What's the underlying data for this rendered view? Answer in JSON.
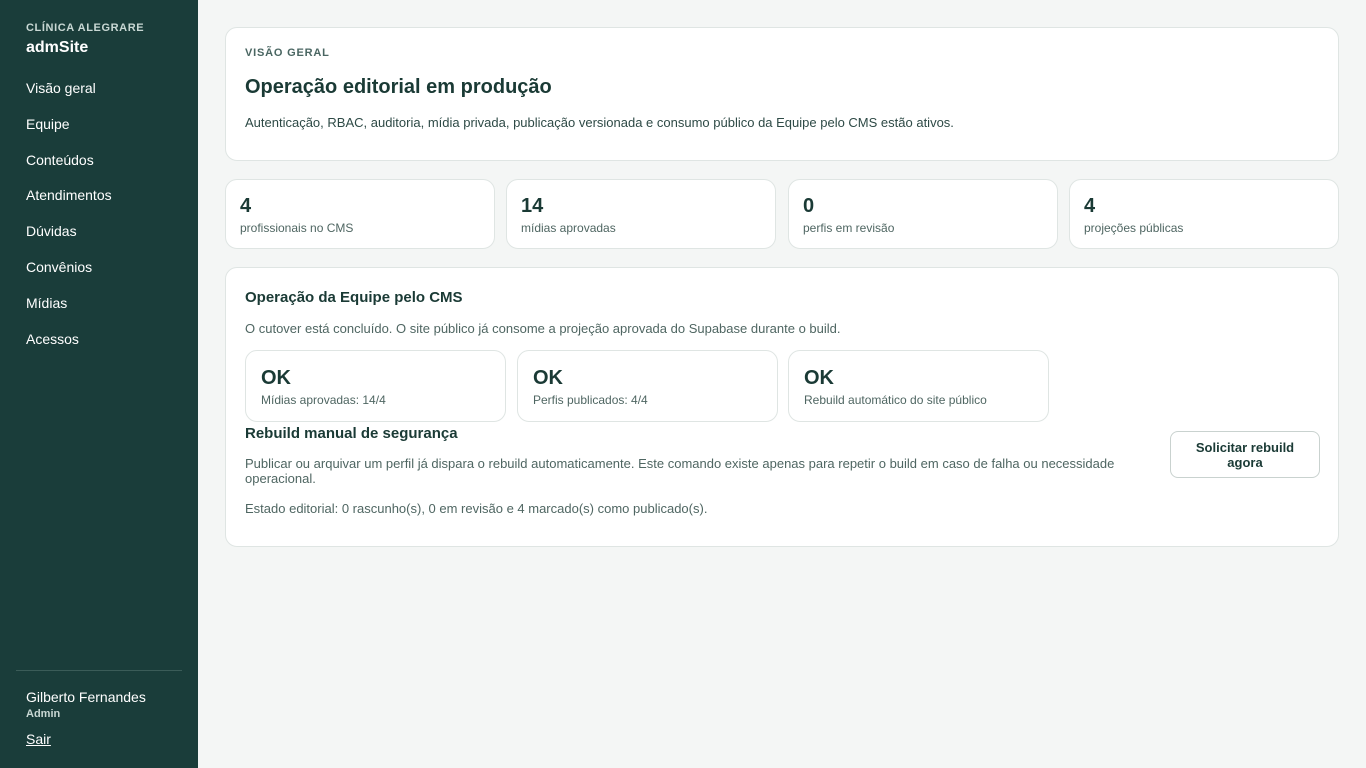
{
  "sidebar": {
    "org": "CLÍNICA ALEGRARE",
    "app_name": "admSite",
    "nav": [
      "Visão geral",
      "Equipe",
      "Conteúdos",
      "Atendimentos",
      "Dúvidas",
      "Convênios",
      "Mídias",
      "Acessos"
    ],
    "user": {
      "name": "Gilberto Fernandes",
      "role": "Admin"
    },
    "logout": "Sair"
  },
  "overview": {
    "eyebrow": "VISÃO GERAL",
    "title": "Operação editorial em produção",
    "description": "Autenticação, RBAC, auditoria, mídia privada, publicação versionada e consumo público da Equipe pelo CMS estão ativos."
  },
  "stats": [
    {
      "value": "4",
      "label": "profissionais no CMS"
    },
    {
      "value": "14",
      "label": "mídias aprovadas"
    },
    {
      "value": "0",
      "label": "perfis em revisão"
    },
    {
      "value": "4",
      "label": "projeções públicas"
    }
  ],
  "operations": {
    "title": "Operação da Equipe pelo CMS",
    "description": "O cutover está concluído. O site público já consome a projeção aprovada do Supabase durante o build.",
    "checks": [
      {
        "status": "OK",
        "label": "Mídias aprovadas: 14/4"
      },
      {
        "status": "OK",
        "label": "Perfis publicados: 4/4"
      },
      {
        "status": "OK",
        "label": "Rebuild automático do site público"
      }
    ],
    "rebuild": {
      "title": "Rebuild manual de segurança",
      "description": "Publicar ou arquivar um perfil já dispara o rebuild automaticamente. Este comando existe apenas para repetir o build em caso de falha ou necessidade operacional.",
      "state": "Estado editorial: 0 rascunho(s), 0 em revisão e 4 marcado(s) como publicado(s).",
      "button_label": "Solicitar rebuild agora"
    }
  },
  "colors": {
    "sidebar_bg": "#1a3d3a",
    "page_bg": "#f4f6f5",
    "text_primary": "#1a3a35"
  }
}
